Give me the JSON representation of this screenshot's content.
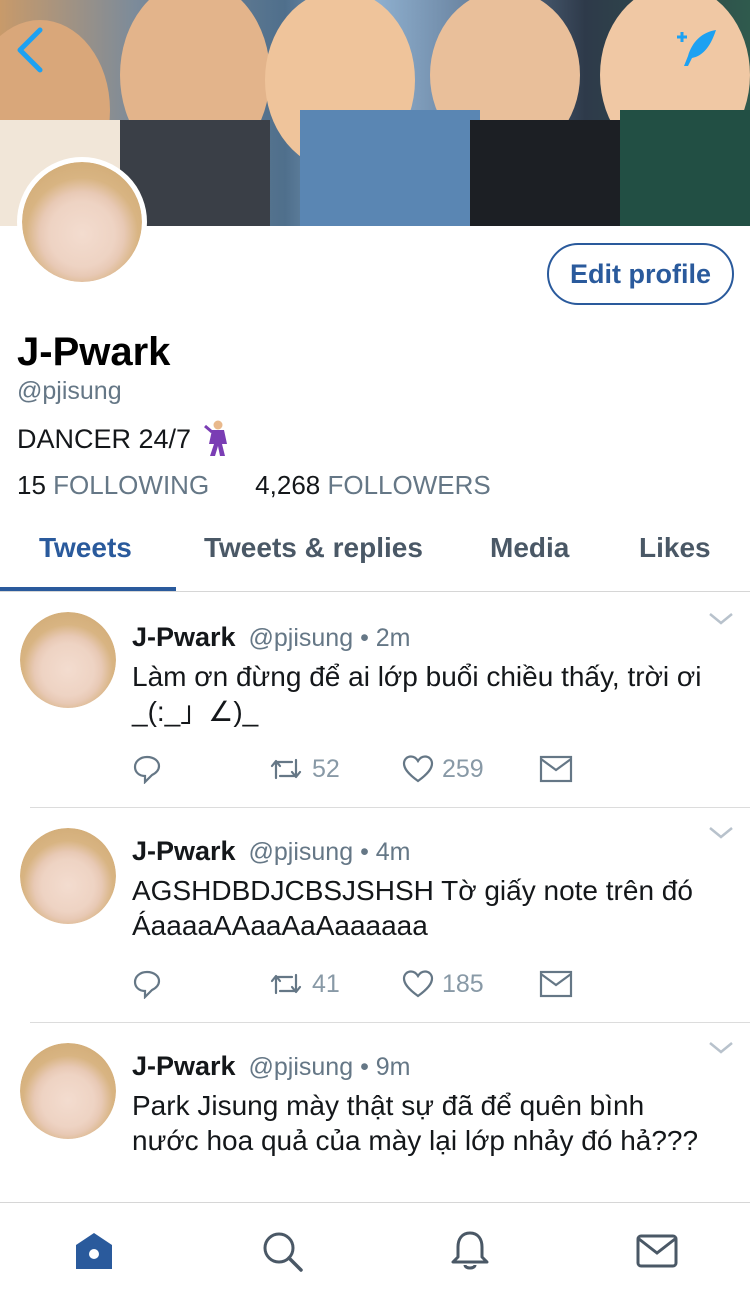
{
  "profile": {
    "name": "J-Pwark",
    "handle": "@pjisung",
    "bio": "DANCER 24/7",
    "bio_emoji": "dancing-man-emoji",
    "following_count": "15",
    "following_label": "FOLLOWING",
    "followers_count": "4,268",
    "followers_label": "FOLLOWERS",
    "edit_label": "Edit profile"
  },
  "tabs": [
    {
      "label": "Tweets",
      "active": true
    },
    {
      "label": "Tweets & replies",
      "active": false
    },
    {
      "label": "Media",
      "active": false
    },
    {
      "label": "Likes",
      "active": false
    }
  ],
  "tweets": [
    {
      "name": "J-Pwark",
      "handle": "@pjisung",
      "time": "• 2m",
      "text": "Làm ơn đừng để ai lớp buổi chiều thấy, trời ơi _(:_」∠)_",
      "retweets": "52",
      "likes": "259"
    },
    {
      "name": "J-Pwark",
      "handle": "@pjisung",
      "time": "• 4m",
      "text": "AGSHDBDJCBSJSHSH Tờ giấy note trên đó ÁaaaaAAaaAaAaaaaaa",
      "retweets": "41",
      "likes": "185"
    },
    {
      "name": "J-Pwark",
      "handle": "@pjisung",
      "time": "• 9m",
      "text": "Park Jisung mày thật sự đã để quên bình nước hoa quả của mày lại lớp nhảy đó hả???",
      "retweets": "",
      "likes": ""
    }
  ],
  "colors": {
    "accent": "#2a5a9c",
    "icon_blue": "#1da1f2",
    "muted": "#657786"
  },
  "icons": {
    "back": "chevron-left-icon",
    "compose": "compose-feather-icon",
    "reply": "reply-icon",
    "retweet": "retweet-icon",
    "like": "heart-icon",
    "dm": "envelope-icon",
    "home": "home-icon",
    "search": "search-icon",
    "notifications": "bell-icon",
    "messages": "mail-icon"
  }
}
